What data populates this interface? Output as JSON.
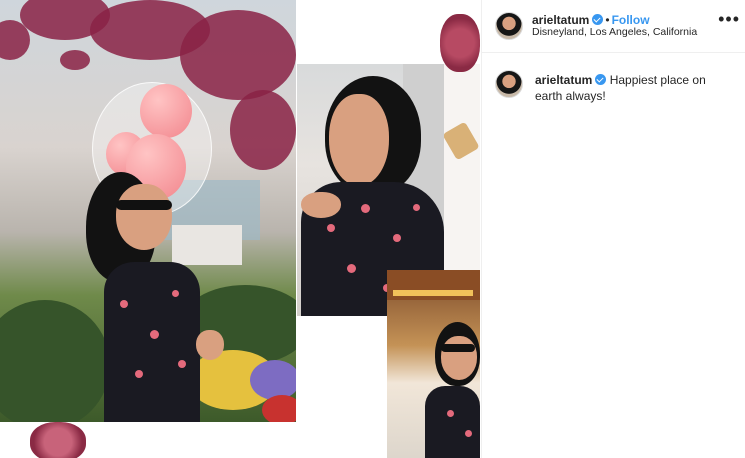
{
  "post": {
    "username": "arieltatum",
    "verified_icon": "verified-badge-icon",
    "separator": "•",
    "follow_label": "Follow",
    "location": "Disneyland, Los Angeles, California",
    "more_icon": "more-options-icon",
    "more_glyph": "•••"
  },
  "caption": {
    "username": "arieltatum",
    "text": "Happiest place on earth always!"
  },
  "colors": {
    "link_blue": "#3897f0",
    "text": "#262626",
    "border": "#efefef"
  }
}
